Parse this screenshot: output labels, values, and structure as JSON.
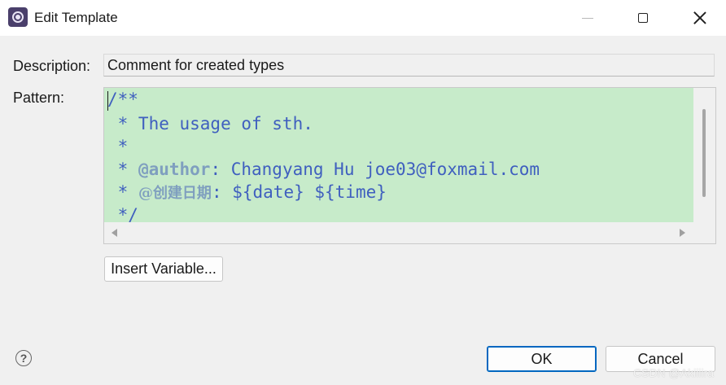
{
  "window": {
    "title": "Edit Template",
    "icon": "eclipse-app-icon"
  },
  "form": {
    "description_label": "Description:",
    "description_value": "Comment for created types",
    "pattern_label": "Pattern:"
  },
  "pattern": {
    "lines": [
      {
        "prefix": "/**",
        "tag": "",
        "rest": ""
      },
      {
        "prefix": " * The usage of sth.",
        "tag": "",
        "rest": ""
      },
      {
        "prefix": " *",
        "tag": "",
        "rest": ""
      },
      {
        "prefix": " * ",
        "tag": "@author",
        "rest": ": Changyang Hu joe03@foxmail.com"
      },
      {
        "prefix": " * ",
        "tag": "@创建日期",
        "rest": ": ${date} ${time}"
      },
      {
        "prefix": " */",
        "tag": "",
        "rest": ""
      }
    ],
    "background_color": "#c7ebca",
    "text_color": "#3f5fbf",
    "tag_color": "#7f9fbf"
  },
  "buttons": {
    "insert_variable": "Insert Variable...",
    "ok": "OK",
    "cancel": "Cancel"
  },
  "help": {
    "glyph": "?"
  },
  "watermark": "CSDN @Akiiiira"
}
